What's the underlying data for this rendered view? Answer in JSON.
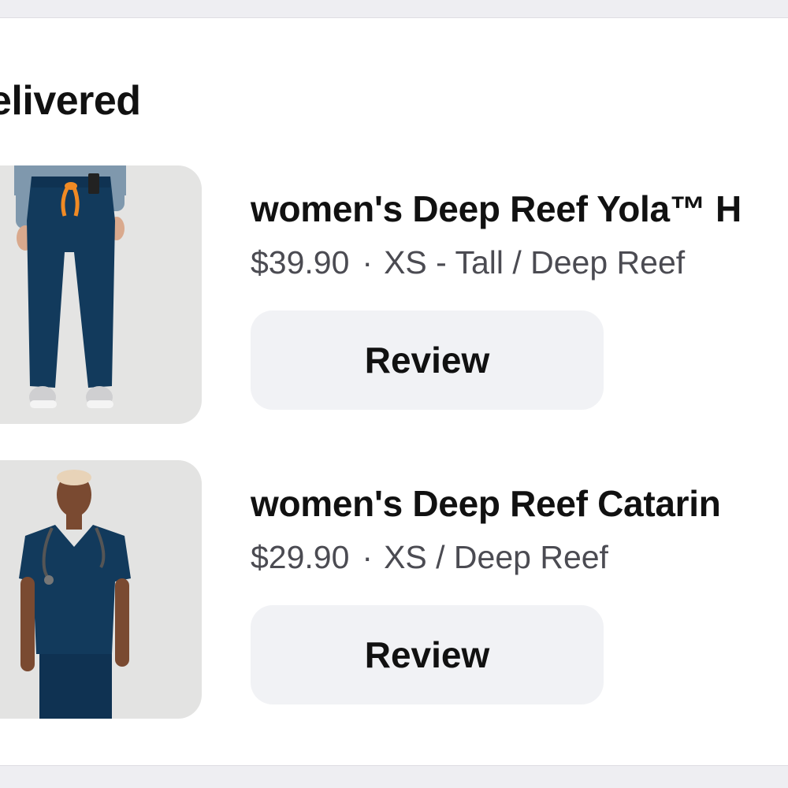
{
  "section": {
    "title": "elivered"
  },
  "orders": [
    {
      "name": "women's Deep Reef Yola™ H",
      "price": "$39.90",
      "separator": "·",
      "variant": "XS - Tall / Deep Reef",
      "action_label": "Review"
    },
    {
      "name": "women's Deep Reef Catarin",
      "price": "$29.90",
      "separator": "·",
      "variant": "XS / Deep Reef",
      "action_label": "Review"
    }
  ],
  "colors": {
    "page_background": "#eeeef2",
    "card_background": "#ffffff",
    "button_background": "#f1f2f5",
    "meta_text": "#4b4b52",
    "product_navy": "#123a5c"
  }
}
